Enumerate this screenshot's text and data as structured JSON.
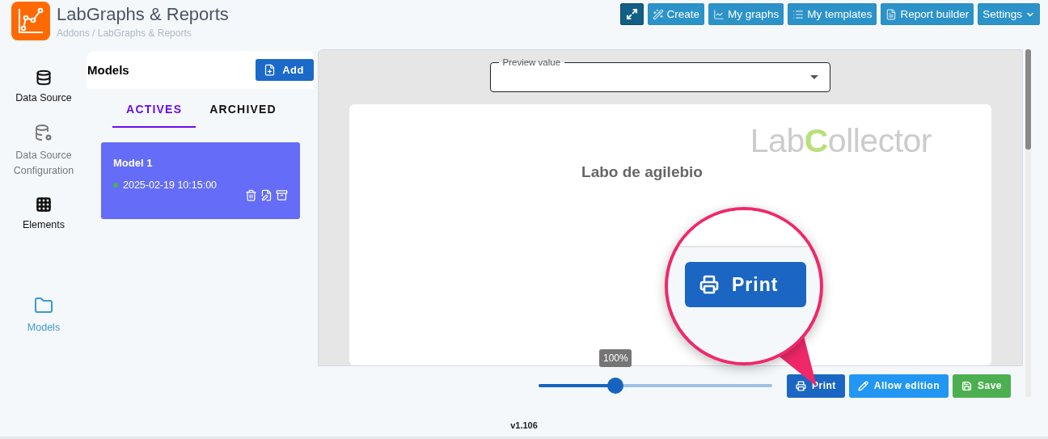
{
  "header": {
    "title": "LabGraphs & Reports",
    "breadcrumb": "Addons / LabGraphs & Reports",
    "buttons": [
      {
        "kind": "icon"
      },
      {
        "kind": "text",
        "label": "Create"
      },
      {
        "kind": "text",
        "label": "My graphs"
      },
      {
        "kind": "text",
        "label": "My templates"
      },
      {
        "kind": "text",
        "label": "Report builder"
      },
      {
        "kind": "menu",
        "label": "Settings"
      }
    ]
  },
  "sidebar": {
    "items": [
      {
        "label": "Data Source",
        "selected": false,
        "disabled": false
      },
      {
        "label": "Data Source Configuration",
        "selected": false,
        "disabled": true
      },
      {
        "label": "Elements",
        "selected": false,
        "disabled": false
      },
      {
        "label": "Models",
        "selected": true,
        "disabled": false
      }
    ]
  },
  "models": {
    "title": "Models",
    "add_button": "Add",
    "tabs": [
      {
        "label": "ACTIVES",
        "selected": true
      },
      {
        "label": "ARCHIVED",
        "selected": false
      }
    ],
    "items": [
      {
        "name": "Model 1",
        "date": "2025-02-19 10:15:00",
        "active": true
      }
    ]
  },
  "preview": {
    "field": {
      "label": "Preview value"
    },
    "logo": "LabCollector",
    "page_title": "Labo de agilebio"
  },
  "callout": {
    "label": "Print"
  },
  "toolbar": {
    "zoom": {
      "reading": "100%",
      "level": 0.33
    },
    "buttons": [
      {
        "kind": "print",
        "label": "Print"
      },
      {
        "kind": "edit",
        "label": "Allow edition"
      },
      {
        "kind": "save",
        "label": "Save"
      }
    ]
  },
  "footer": {
    "version": "v1.106"
  }
}
